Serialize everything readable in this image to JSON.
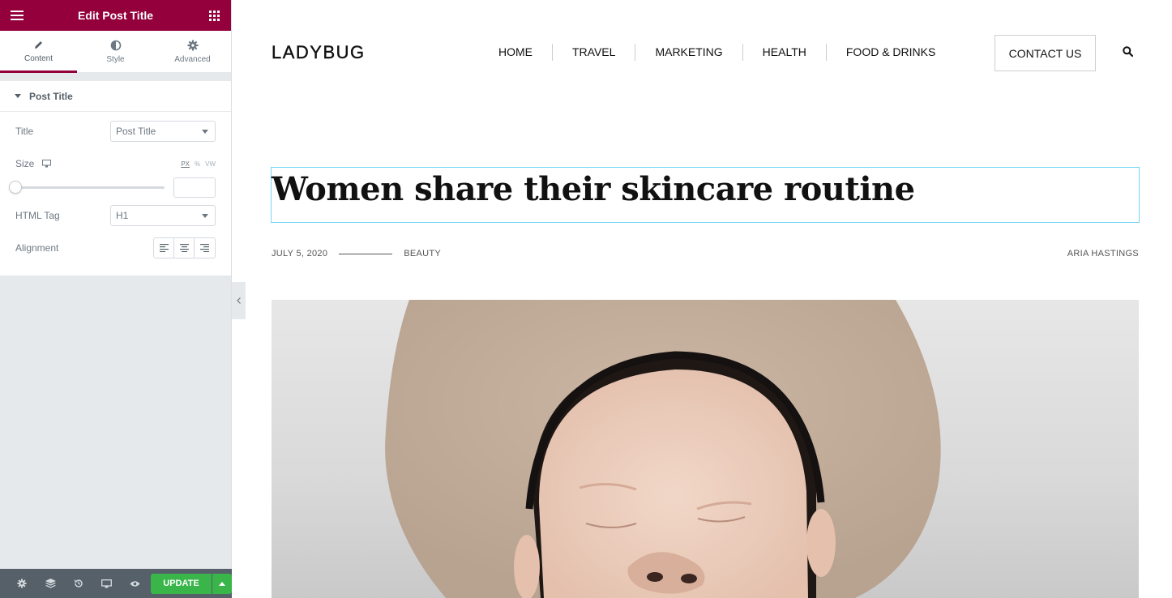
{
  "panel": {
    "header_title": "Edit Post Title",
    "tabs": [
      {
        "label": "Content",
        "icon": "pencil-icon",
        "active": true
      },
      {
        "label": "Style",
        "icon": "contrast-icon",
        "active": false
      },
      {
        "label": "Advanced",
        "icon": "gear-icon",
        "active": false
      }
    ],
    "section_title": "Post Title",
    "controls": {
      "title_label": "Title",
      "title_value": "Post Title",
      "size_label": "Size",
      "units": [
        "PX",
        "%",
        "VW"
      ],
      "size_value": "",
      "html_tag_label": "HTML Tag",
      "html_tag_value": "H1",
      "alignment_label": "Alignment"
    },
    "footer": {
      "update_label": "UPDATE",
      "update_color": "#39b54a"
    },
    "accent_color": "#93003c"
  },
  "site": {
    "logo": "LADYBUG",
    "nav": [
      "HOME",
      "TRAVEL",
      "MARKETING",
      "HEALTH",
      "FOOD & DRINKS"
    ],
    "contact_label": "CONTACT US",
    "post_title": "Women share their skincare routine",
    "meta": {
      "date": "JULY 5, 2020",
      "category": "BEAUTY",
      "author": "ARIA HASTINGS"
    }
  }
}
